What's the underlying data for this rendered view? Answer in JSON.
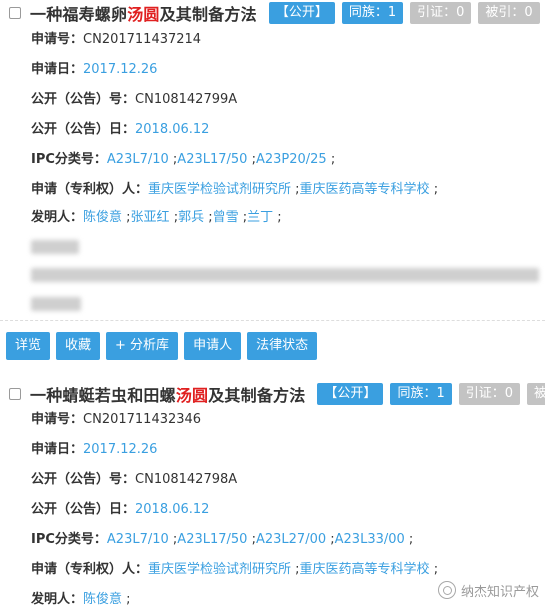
{
  "records": [
    {
      "title_parts": [
        "一种福寿螺卵",
        "汤圆",
        "及其制备方法"
      ],
      "status_badge": "【公开】",
      "family_badge": "同族：1",
      "cited_badge": "引证：0",
      "citedby_badge": "被引：0",
      "app_no_label": "申请号：",
      "app_no": "CN201711437214",
      "app_date_label": "申请日：",
      "app_date": "2017.12.26",
      "pub_no_label": "公开（公告）号：",
      "pub_no": "CN108142799A",
      "pub_date_label": "公开（公告）日：",
      "pub_date": "2018.06.12",
      "ipc_label": "IPC分类号：",
      "ipc": [
        "A23L7/10",
        "A23L17/50",
        "A23P20/25"
      ],
      "applicant_label": "申请（专利权）人：",
      "applicants": [
        "重庆医学检验试剂研究所",
        "重庆医药高等专科学校"
      ],
      "inventor_label": "发明人：",
      "inventors": [
        "陈俊意",
        "张亚红",
        "郭兵",
        "曾雪",
        "兰丁"
      ],
      "actions": [
        "详览",
        "收藏",
        "+ 分析库",
        "申请人",
        "法律状态"
      ]
    },
    {
      "title_parts": [
        "一种蜻蜓若虫和田螺",
        "汤圆",
        "及其制备方法"
      ],
      "status_badge": "【公开】",
      "family_badge": "同族：1",
      "cited_badge": "引证：0",
      "citedby_badge": "被引",
      "app_no_label": "申请号：",
      "app_no": "CN201711432346",
      "app_date_label": "申请日：",
      "app_date": "2017.12.26",
      "pub_no_label": "公开（公告）号：",
      "pub_no": "CN108142798A",
      "pub_date_label": "公开（公告）日：",
      "pub_date": "2018.06.12",
      "ipc_label": "IPC分类号：",
      "ipc": [
        "A23L7/10",
        "A23L17/50",
        "A23L27/00",
        "A23L33/00"
      ],
      "applicant_label": "申请（专利权）人：",
      "applicants": [
        "重庆医学检验试剂研究所",
        "重庆医药高等专科学校"
      ],
      "inventor_label": "发明人：",
      "inventors": [
        "陈俊意"
      ]
    }
  ],
  "watermark": "纳杰知识产权",
  "colors": {
    "accent": "#3a9fe0",
    "highlight": "#e02020",
    "muted_badge": "#c3c3c3"
  },
  "icons": {
    "checkbox": "checkbox-icon",
    "watermark_logo": "wechat-logo-icon"
  }
}
